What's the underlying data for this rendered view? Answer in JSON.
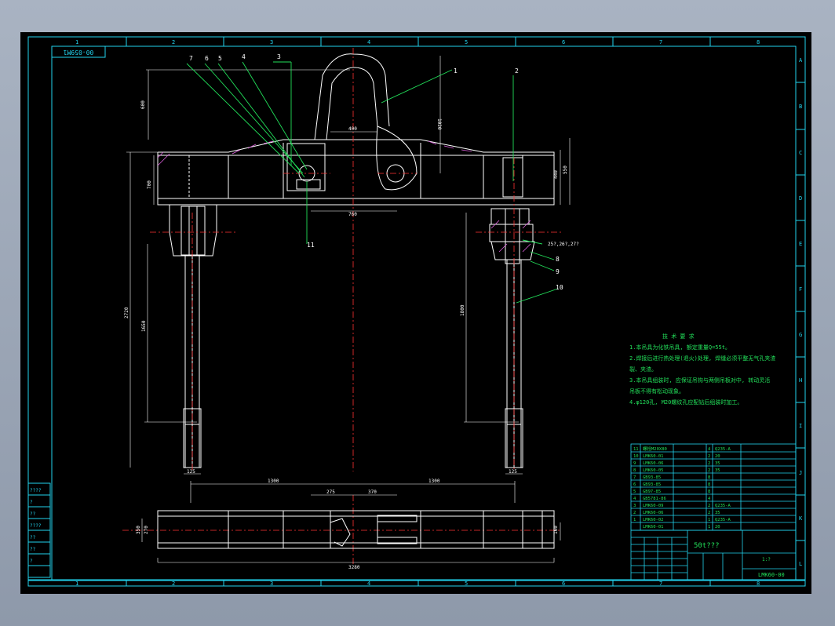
{
  "drawing_code_flipped": "00-059M1",
  "zone_columns": [
    "1",
    "2",
    "3",
    "4",
    "5",
    "6",
    "7",
    "8"
  ],
  "zone_rows": [
    "A",
    "B",
    "C",
    "D",
    "E",
    "F",
    "G",
    "H",
    "I",
    "J",
    "K",
    "L"
  ],
  "balloons": [
    "7",
    "6",
    "5",
    "4",
    "3",
    "1",
    "2",
    "11",
    "8",
    "9",
    "10"
  ],
  "dimensions": {
    "d600": "600",
    "d400": "400",
    "d1020": "1020",
    "d440": "440",
    "d550": "550",
    "d700": "700",
    "d760": "760",
    "d2720": "2720",
    "d1650": "1650",
    "d1800": "1800",
    "d125a": "125",
    "d125b": "125",
    "thread": "25?,26?,27?",
    "d1300a": "1300",
    "d1300b": "1300",
    "d275": "275",
    "d370": "370",
    "d350": "350",
    "d270": "270",
    "d160": "160",
    "d3280": "3280"
  },
  "notes": {
    "heading": "技 术 要 求",
    "lines": [
      "1.本吊具为化铁吊具, 额定重量Q=55t。",
      "2.焊接后进行热处理(退火)处理, 焊缝必须平整无气孔夹渣",
      "裂、夹渣。",
      "3.本吊具组装时, 应保证吊钩与两侧吊板对中, 转动灵活",
      "吊板不得有松动现象。",
      "4.φ120孔, M20螺纹孔应配钻后组装时加工。"
    ]
  },
  "bom": [
    [
      "11",
      "螺栓M20X80",
      "4",
      "Q235-A"
    ],
    [
      "10",
      "LMK60-01",
      "2",
      "20"
    ],
    [
      "9",
      "LMK60-06",
      "2",
      "35"
    ],
    [
      "8",
      "LMK60-05",
      "2",
      "35"
    ],
    [
      "7",
      "GB93-85",
      "8",
      ""
    ],
    [
      "6",
      "GB93-85",
      "8",
      ""
    ],
    [
      "5",
      "GB97-85",
      "8",
      ""
    ],
    [
      "4",
      "GB5781-86",
      "4",
      ""
    ],
    [
      "3",
      "LMK60-09",
      "2",
      "Q235-A"
    ],
    [
      "2",
      "LMK60-06",
      "2",
      "35"
    ],
    [
      "1",
      "LMK60-02",
      "1",
      "Q235-A"
    ],
    [
      "",
      "LMK60-01",
      "1",
      "20"
    ]
  ],
  "title_block": {
    "name": "50t???",
    "scale": "1:?",
    "drawing_no": "LMK60-00"
  },
  "left_strip": [
    "????",
    "?",
    "??",
    "????",
    "??",
    "??",
    "?"
  ]
}
